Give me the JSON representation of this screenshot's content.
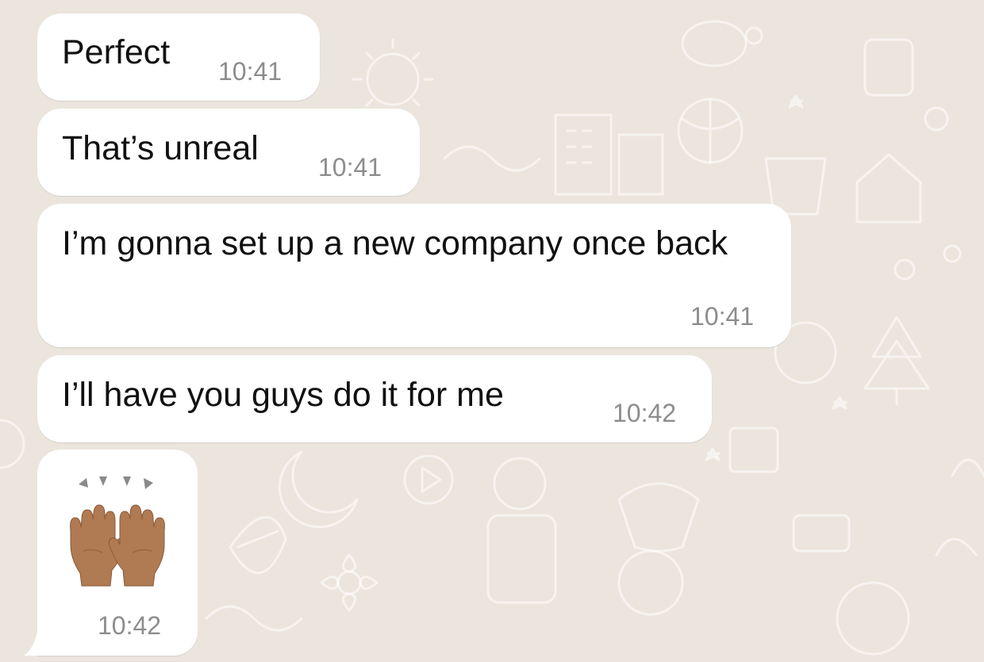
{
  "chat": {
    "background_color": "#ECE5DD",
    "bubble_color": "#FFFFFF",
    "messages": [
      {
        "text": "Perfect",
        "time": "10:41"
      },
      {
        "text": "That’s unreal",
        "time": "10:41"
      },
      {
        "text": "I’m gonna set up a new company once back",
        "time": "10:41"
      },
      {
        "text": "I’ll have you guys do it for me",
        "time": "10:42"
      },
      {
        "emoji": "raising-hands-medium-skin-tone",
        "time": "10:42"
      }
    ]
  }
}
